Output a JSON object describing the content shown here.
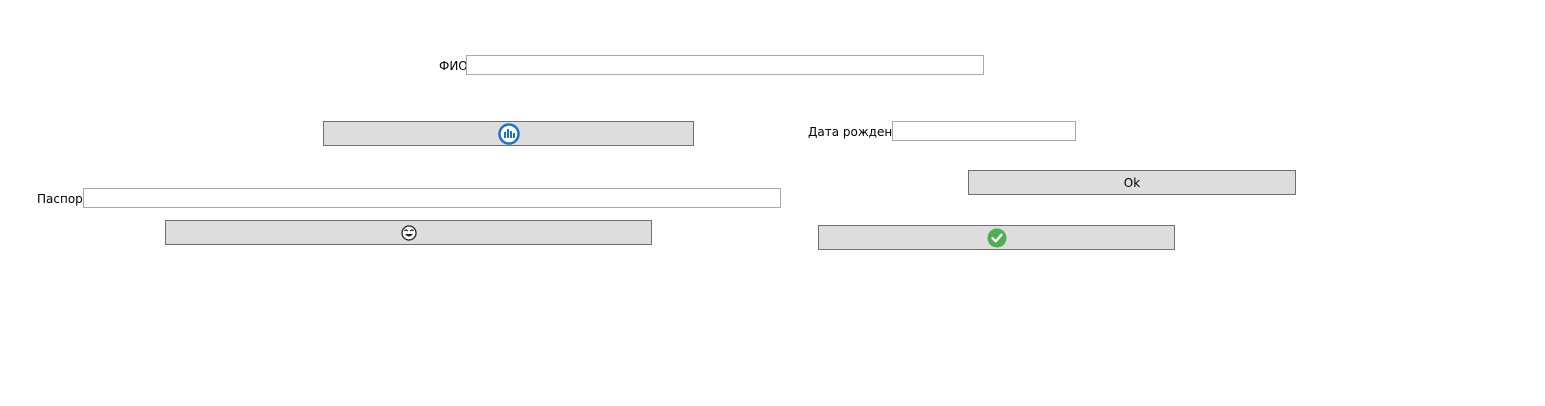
{
  "form": {
    "fio_label": "ФИО",
    "fio_value": "",
    "birthdate_label": "Дата рождения",
    "birthdate_value": "",
    "passport_label": "Паспорт",
    "passport_value": "",
    "ok_button_label": "Ok"
  },
  "icons": {
    "top_left_button": "bar-chart-circle-icon",
    "passport_button": "emoji-face-icon",
    "confirm_button": "green-checkmark-icon"
  },
  "colors": {
    "button_bg": "#dddddd",
    "button_border": "#707070",
    "input_border": "#a9a9a9",
    "chart_icon_blue": "#1a73c8",
    "check_green": "#4caf50"
  }
}
